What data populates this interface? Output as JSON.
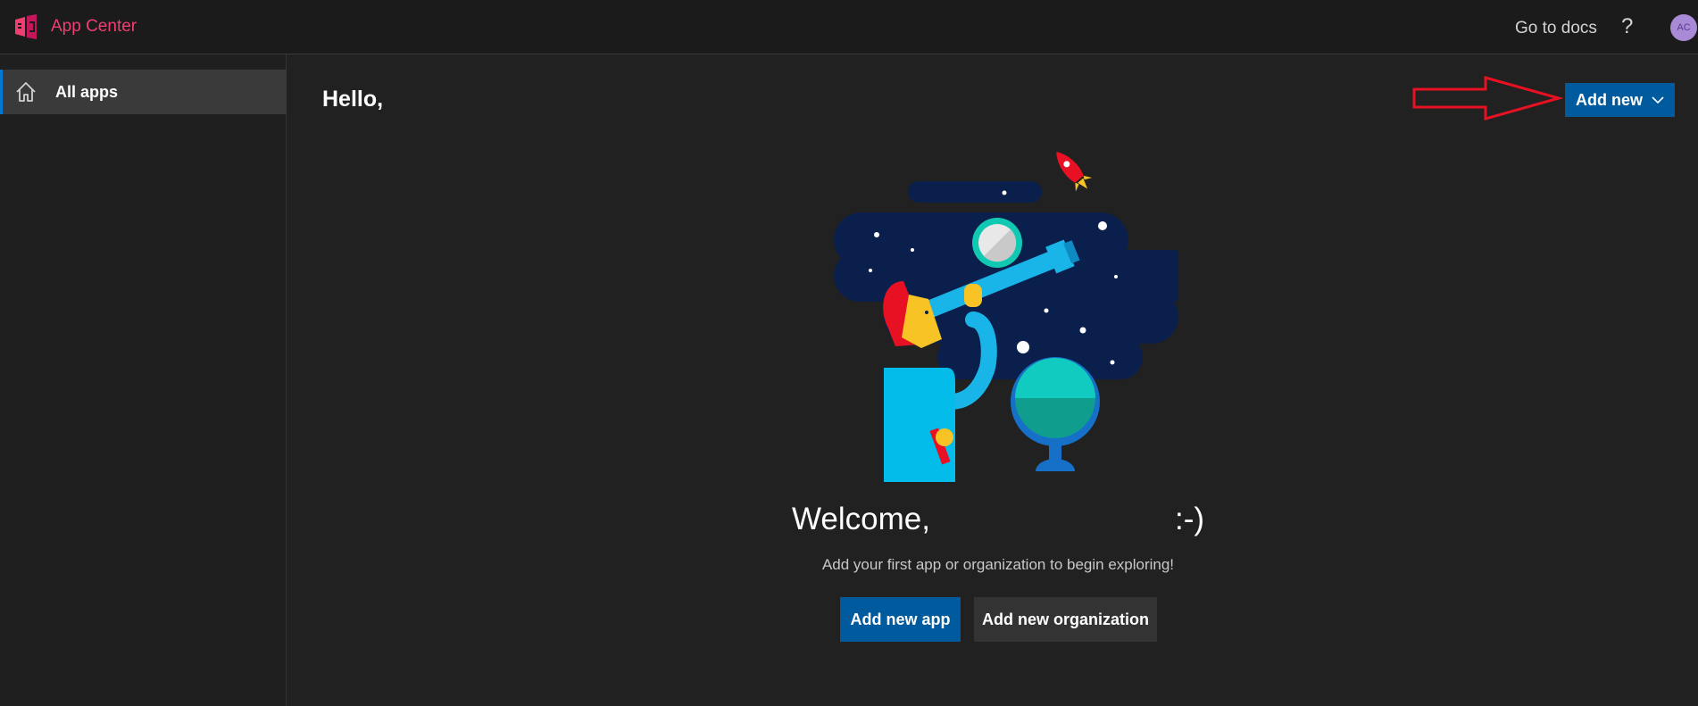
{
  "header": {
    "app_name": "App Center",
    "docs_link": "Go to docs",
    "help_symbol": "?",
    "avatar_initials": "AC",
    "brand_color": "#ef3f72"
  },
  "sidebar": {
    "items": [
      {
        "label": "All apps",
        "icon": "home-icon",
        "selected": true
      }
    ]
  },
  "main": {
    "greeting": "Hello,",
    "add_new_label": "Add new",
    "welcome_text": "Welcome,",
    "welcome_emoticon": ":-)",
    "subtitle": "Add your first app or organization to begin exploring!",
    "add_app_label": "Add new app",
    "add_org_label": "Add new organization"
  },
  "colors": {
    "primary_button": "#005a9e",
    "annotation_arrow": "#e81123",
    "background": "#212121"
  }
}
